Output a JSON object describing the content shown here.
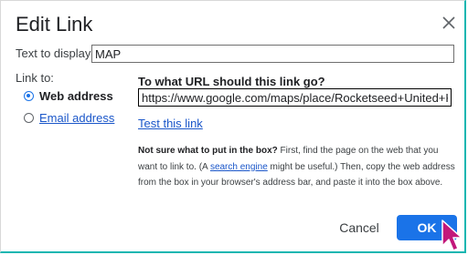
{
  "dialog": {
    "title": "Edit Link",
    "close_icon": "close-icon"
  },
  "text_to_display": {
    "label": "Text to display:",
    "value": "MAP"
  },
  "link_to": {
    "label": "Link to:",
    "options": [
      {
        "label": "Web address",
        "selected": true
      },
      {
        "label": "Email address",
        "selected": false
      }
    ]
  },
  "url_section": {
    "question": "To what URL should this link go?",
    "value": "https://www.google.com/maps/place/Rocketseed+United+Kingdom",
    "test_link": "Test this link"
  },
  "help": {
    "bold_lead": "Not sure what to put in the box?",
    "text_1": " First, find the page on the web that you want to link to. (A ",
    "link": "search engine",
    "text_2": " might be useful.) Then, copy the web address from the box in your browser's address bar, and paste it into the box above."
  },
  "buttons": {
    "cancel": "Cancel",
    "ok": "OK"
  },
  "colors": {
    "accent": "#1a73e8",
    "link": "#1a56c9",
    "cursor": "#c2187a",
    "frame_edge": "#13b6b1"
  }
}
